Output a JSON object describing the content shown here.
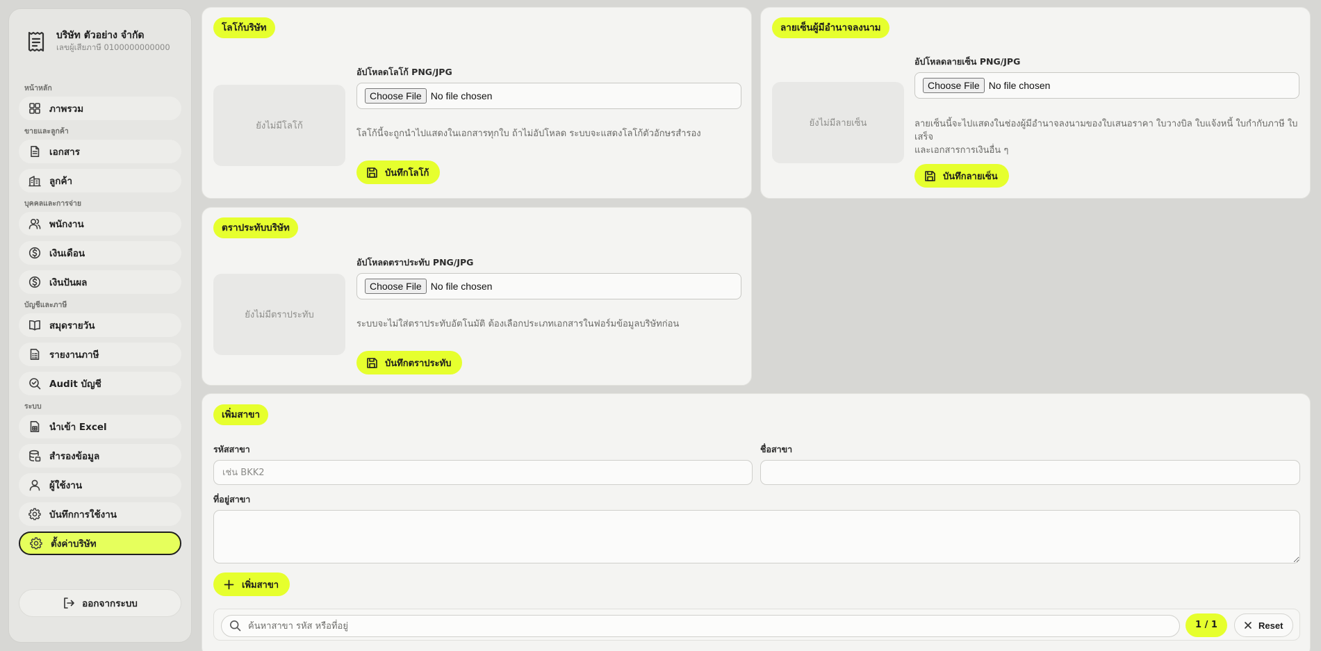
{
  "company": {
    "name": "บริษัท ตัวอย่าง จำกัด",
    "tax_id": "เลขผู้เสียภาษี 0100000000000"
  },
  "sidebar": {
    "groups": [
      {
        "label": "หน้าหลัก"
      },
      {
        "label": "ขายและลูกค้า"
      },
      {
        "label": "บุคคลและการจ่าย"
      },
      {
        "label": "บัญชีและภาษี"
      },
      {
        "label": "ระบบ"
      }
    ],
    "items": [
      {
        "label": "ภาพรวม",
        "icon": "dashboard-icon"
      },
      {
        "label": "เอกสาร",
        "icon": "document-icon"
      },
      {
        "label": "ลูกค้า",
        "icon": "building-icon"
      },
      {
        "label": "พนักงาน",
        "icon": "users-icon"
      },
      {
        "label": "เงินเดือน",
        "icon": "dollar-circle-icon"
      },
      {
        "label": "เงินปันผล",
        "icon": "dollar-circle-icon"
      },
      {
        "label": "สมุดรายวัน",
        "icon": "book-icon"
      },
      {
        "label": "รายงานภาษี",
        "icon": "report-icon"
      },
      {
        "label": "Audit บัญชี",
        "icon": "audit-search-icon"
      },
      {
        "label": "นำเข้า Excel",
        "icon": "file-spreadsheet-icon"
      },
      {
        "label": "สำรองข้อมูล",
        "icon": "database-icon"
      },
      {
        "label": "ผู้ใช้งาน",
        "icon": "user-icon"
      },
      {
        "label": "บันทึกการใช้งาน",
        "icon": "gear-icon"
      },
      {
        "label": "ตั้งค่าบริษัท",
        "icon": "gear-icon",
        "active": true
      }
    ],
    "logout": "ออกจากระบบ"
  },
  "logo_card": {
    "title": "โลโก้บริษัท",
    "preview_empty": "ยังไม่มีโลโก้",
    "upload_label": "อัปโหลดโลโก้ PNG/JPG",
    "choose_file": "Choose File",
    "file_status": "No file chosen",
    "hint": "โลโก้นี้จะถูกนำไปแสดงในเอกสารทุกใบ ถ้าไม่อัปโหลด ระบบจะแสดงโลโก้ตัวอักษรสำรอง",
    "save": "บันทึกโลโก้"
  },
  "signature_card": {
    "title": "ลายเซ็นผู้มีอำนาจลงนาม",
    "preview_empty": "ยังไม่มีลายเซ็น",
    "upload_label": "อัปโหลดลายเซ็น PNG/JPG",
    "choose_file": "Choose File",
    "file_status": "No file chosen",
    "hint_line1": "ลายเซ็นนี้จะไปแสดงในช่องผู้มีอำนาจลงนามของใบเสนอราคา ใบวางบิล ใบแจ้งหนี้ ใบกำกับภาษี ใบเสร็จ",
    "hint_line2": "และเอกสารการเงินอื่น ๆ",
    "save": "บันทึกลายเซ็น"
  },
  "stamp_card": {
    "title": "ตราประทับบริษัท",
    "preview_empty": "ยังไม่มีตราประทับ",
    "upload_label": "อัปโหลดตราประทับ PNG/JPG",
    "choose_file": "Choose File",
    "file_status": "No file chosen",
    "hint": "ระบบจะไม่ใส่ตราประทับอัตโนมัติ ต้องเลือกประเภทเอกสารในฟอร์มข้อมูลบริษัทก่อน",
    "save": "บันทึกตราประทับ"
  },
  "branch_card": {
    "title": "เพิ่มสาขา",
    "code_label": "รหัสสาขา",
    "code_placeholder": "เช่น BKK2",
    "code_value": "",
    "name_label": "ชื่อสาขา",
    "name_value": "",
    "address_label": "ที่อยู่สาขา",
    "address_value": "",
    "add_button": "เพิ่มสาขา",
    "search_placeholder": "ค้นหาสาขา รหัส หรือที่อยู่",
    "page_count": "1 / 1",
    "reset": "Reset"
  },
  "colors": {
    "accent": "#e6ff2e",
    "background": "#d7d7d4",
    "card": "#f4f4f2"
  }
}
